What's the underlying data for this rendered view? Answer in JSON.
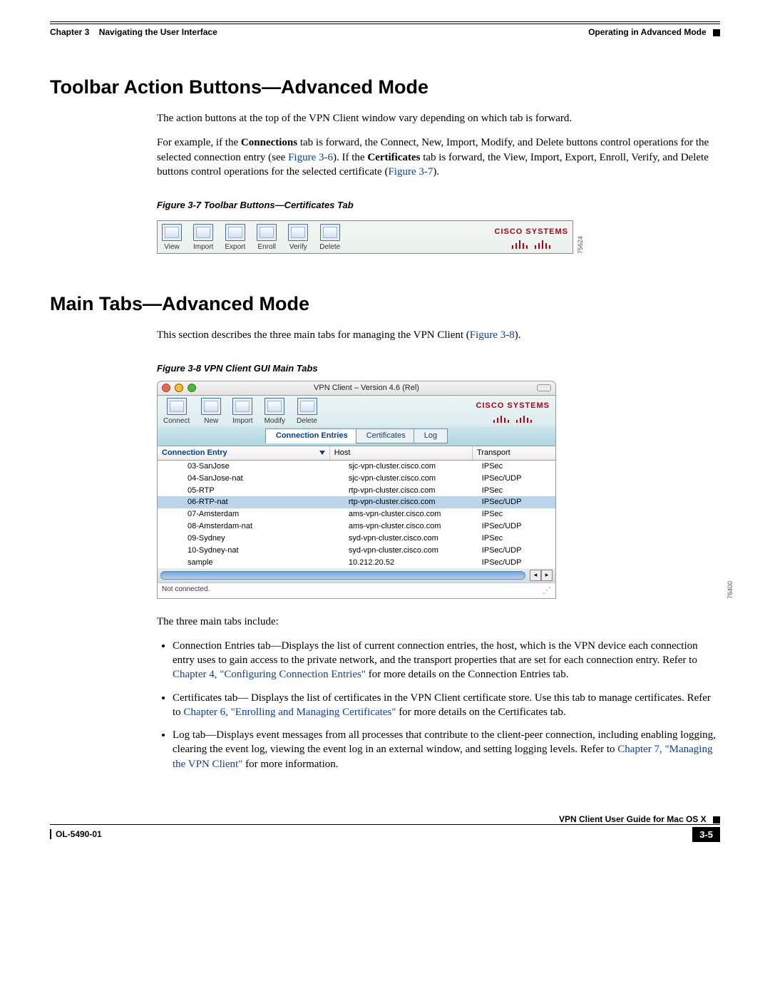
{
  "header": {
    "chapter_label": "Chapter 3",
    "chapter_title": "Navigating the User Interface",
    "section_title": "Operating in Advanced Mode"
  },
  "section1": {
    "heading": "Toolbar Action Buttons—Advanced Mode",
    "p1": "The action buttons at the top of the VPN Client window vary depending on which tab is forward.",
    "p2a": "For example, if the ",
    "p2b_bold": "Connections",
    "p2c": " tab is forward, the Connect, New, Import, Modify, and Delete buttons control operations for the selected connection entry (see ",
    "p2_link1": "Figure 3-6",
    "p2d": "). If the ",
    "p2e_bold": "Certificates",
    "p2f": " tab is forward, the View, Import, Export, Enroll, Verify, and Delete buttons control operations for the selected certificate (",
    "p2_link2": "Figure 3-7",
    "p2g": ").",
    "fig_caption": "Figure 3-7    Toolbar Buttons—Certificates Tab",
    "toolbar_buttons": [
      "View",
      "Import",
      "Export",
      "Enroll",
      "Verify",
      "Delete"
    ],
    "cisco": "CISCO SYSTEMS",
    "refnum": "75624"
  },
  "section2": {
    "heading": "Main Tabs—Advanced Mode",
    "p1a": "This section describes the three main tabs for managing the VPN Client (",
    "p1_link": "Figure 3-8",
    "p1b": ").",
    "fig_caption": "Figure 3-8    VPN Client GUI Main Tabs",
    "window": {
      "title": "VPN Client – Version 4.6 (Rel)",
      "toolbar_buttons": [
        "Connect",
        "New",
        "Import",
        "Modify",
        "Delete"
      ],
      "cisco": "CISCO SYSTEMS",
      "tabs": [
        "Connection Entries",
        "Certificates",
        "Log"
      ],
      "active_tab": "Connection Entries",
      "columns": {
        "entry": "Connection Entry",
        "host": "Host",
        "transport": "Transport"
      },
      "rows": [
        {
          "entry": "03-SanJose",
          "host": "sjc-vpn-cluster.cisco.com",
          "transport": "IPSec",
          "selected": false
        },
        {
          "entry": "04-SanJose-nat",
          "host": "sjc-vpn-cluster.cisco.com",
          "transport": "IPSec/UDP",
          "selected": false
        },
        {
          "entry": "05-RTP",
          "host": "rtp-vpn-cluster.cisco.com",
          "transport": "IPSec",
          "selected": false
        },
        {
          "entry": "06-RTP-nat",
          "host": "rtp-vpn-cluster.cisco.com",
          "transport": "IPSec/UDP",
          "selected": true
        },
        {
          "entry": "07-Amsterdam",
          "host": "ams-vpn-cluster.cisco.com",
          "transport": "IPSec",
          "selected": false
        },
        {
          "entry": "08-Amsterdam-nat",
          "host": "ams-vpn-cluster.cisco.com",
          "transport": "IPSec/UDP",
          "selected": false
        },
        {
          "entry": "09-Sydney",
          "host": "syd-vpn-cluster.cisco.com",
          "transport": "IPSec",
          "selected": false
        },
        {
          "entry": "10-Sydney-nat",
          "host": "syd-vpn-cluster.cisco.com",
          "transport": "IPSec/UDP",
          "selected": false
        },
        {
          "entry": "sample",
          "host": "10.212.20.52",
          "transport": "IPSec/UDP",
          "selected": false
        }
      ],
      "status": "Not connected.",
      "refnum": "76400"
    },
    "after_fig": "The three main tabs include:",
    "bullet1a": "Connection Entries tab—Displays the list of current connection entries, the host, which is the VPN device each connection entry uses to gain access to the private network, and the transport properties that are set for each connection entry. Refer to ",
    "bullet1_link": "Chapter 4, \"Configuring Connection Entries\"",
    "bullet1b": " for more details on the Connection Entries tab.",
    "bullet2a": "Certificates tab— Displays the list of certificates in the VPN Client certificate store. Use this tab to manage certificates. Refer to ",
    "bullet2_link": "Chapter 6, \"Enrolling and Managing Certificates\"",
    "bullet2b": " for more details on the Certificates tab.",
    "bullet3a": "Log tab—Displays event messages from all processes that contribute to the client-peer connection, including enabling logging, clearing the event log, viewing the event log in an external window, and setting logging levels. Refer to ",
    "bullet3_link": "Chapter 7, \"Managing the VPN Client\"",
    "bullet3b": " for more information."
  },
  "footer": {
    "guide": "VPN Client User Guide for Mac OS X",
    "docnum": "OL-5490-01",
    "pagenum": "3-5"
  }
}
